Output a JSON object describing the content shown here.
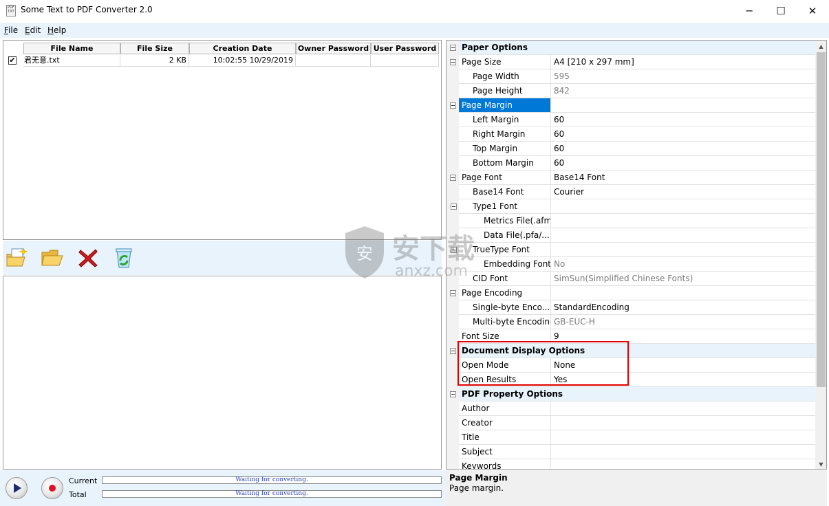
{
  "window": {
    "title": "Some Text to PDF Converter 2.0",
    "app_icon_text": "PDF TXT",
    "controls": {
      "minimize": "─",
      "maximize": "☐",
      "close": "✕"
    }
  },
  "menu": [
    {
      "label": "File",
      "accel": "F",
      "rest": "ile"
    },
    {
      "label": "Edit",
      "accel": "E",
      "rest": "dit"
    },
    {
      "label": "Help",
      "accel": "H",
      "rest": "elp"
    }
  ],
  "file_list": {
    "columns": [
      "File Name",
      "File Size",
      "Creation Date",
      "Owner Password",
      "User Password"
    ],
    "rows": [
      {
        "checked": true,
        "check_mark": "✔",
        "name": "君无意.txt",
        "size": "2 KB",
        "date": "10:02:55 10/29/2019",
        "owner_password": "",
        "user_password": ""
      }
    ]
  },
  "toolbar": {
    "buttons": [
      "add-files-icon",
      "open-folder-icon",
      "delete-icon",
      "recycle-icon"
    ]
  },
  "progress": {
    "current_label": "Current",
    "total_label": "Total",
    "current_text": "Waiting for converting.",
    "total_text": "Waiting for converting."
  },
  "properties": {
    "rows": [
      {
        "type": "cat",
        "name": "Paper Options"
      },
      {
        "type": "parent",
        "name": "Page Size",
        "value": "A4 [210 x 297 mm]"
      },
      {
        "type": "child",
        "name": "Page Width",
        "value": "595",
        "grey": true
      },
      {
        "type": "child",
        "name": "Page Height",
        "value": "842",
        "grey": true
      },
      {
        "type": "parent",
        "name": "Page Margin",
        "value": "",
        "selected": true
      },
      {
        "type": "child",
        "name": "Left Margin",
        "value": "60"
      },
      {
        "type": "child",
        "name": "Right Margin",
        "value": "60"
      },
      {
        "type": "child",
        "name": "Top Margin",
        "value": "60"
      },
      {
        "type": "child",
        "name": "Bottom Margin",
        "value": "60"
      },
      {
        "type": "parent",
        "name": "Page Font",
        "value": "Base14 Font"
      },
      {
        "type": "child",
        "name": "Base14 Font",
        "value": "Courier"
      },
      {
        "type": "childparent",
        "name": "Type1 Font",
        "value": ""
      },
      {
        "type": "grandchild",
        "name": "Metrics File(.afm)",
        "value": ""
      },
      {
        "type": "grandchild",
        "name": "Data File(.pfa/...",
        "value": ""
      },
      {
        "type": "childparent",
        "name": "TrueType Font",
        "value": ""
      },
      {
        "type": "grandchild",
        "name": "Embedding Font",
        "value": "No",
        "grey": true
      },
      {
        "type": "child",
        "name": "CID Font",
        "value": "SimSun(Simplified Chinese Fonts)",
        "grey": true
      },
      {
        "type": "parent",
        "name": "Page Encoding",
        "value": ""
      },
      {
        "type": "child",
        "name": "Single-byte Enco...",
        "value": "StandardEncoding"
      },
      {
        "type": "child",
        "name": "Multi-byte Encoding",
        "value": "GB-EUC-H",
        "grey": true
      },
      {
        "type": "plain",
        "name": "Font Size",
        "value": "9"
      },
      {
        "type": "cat",
        "name": "Document Display Options"
      },
      {
        "type": "plain",
        "name": "Open Mode",
        "value": "None"
      },
      {
        "type": "plain",
        "name": "Open Results",
        "value": "Yes"
      },
      {
        "type": "cat",
        "name": "PDF Property Options"
      },
      {
        "type": "plain",
        "name": "Author",
        "value": ""
      },
      {
        "type": "plain",
        "name": "Creator",
        "value": ""
      },
      {
        "type": "plain",
        "name": "Title",
        "value": ""
      },
      {
        "type": "plain",
        "name": "Subject",
        "value": ""
      },
      {
        "type": "plain",
        "name": "Keywords",
        "value": ""
      }
    ],
    "scroll_up": "▲",
    "scroll_down": "▼"
  },
  "description": {
    "title": "Page Margin",
    "text": "Page margin."
  },
  "watermark": {
    "main": "安下载",
    "sub": "anxz.com",
    "badge": "安"
  },
  "colors": {
    "accent_bar": "#e8f3fb",
    "selection": "#0078d7",
    "highlight_box": "#e10000"
  }
}
